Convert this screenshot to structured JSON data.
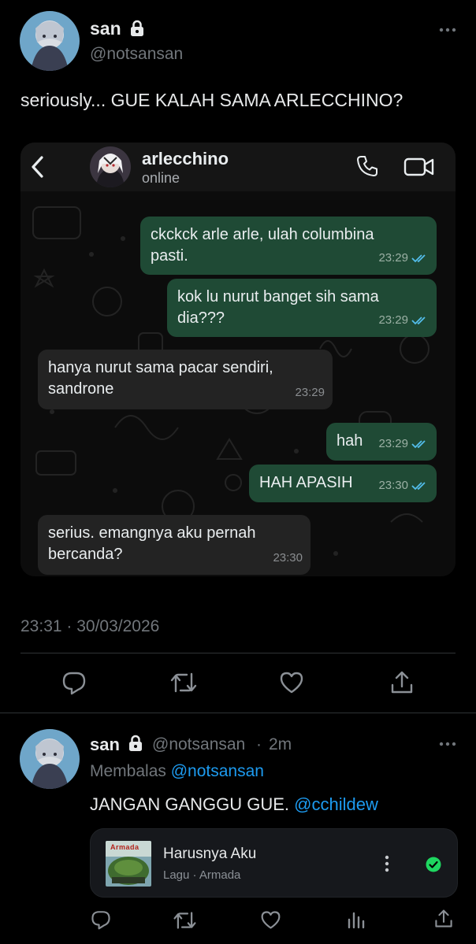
{
  "tweet": {
    "display_name": "san",
    "handle": "@notsansan",
    "text": "seriously... GUE KALAH SAMA ARLECCHINO?",
    "timestamp": "23:31 · 30/03/2026"
  },
  "chat": {
    "contact_name": "arlecchino",
    "status": "online",
    "messages": [
      {
        "text": "ckckck arle arle, ulah columbina\npasti.",
        "time": "23:29",
        "direction": "out"
      },
      {
        "text": "kok lu nurut banget sih sama\ndia???",
        "time": "23:29",
        "direction": "out"
      },
      {
        "text": "hanya nurut sama pacar sendiri,\nsandrone",
        "time": "23:29",
        "direction": "in"
      },
      {
        "text": "hah",
        "time": "23:29",
        "direction": "out"
      },
      {
        "text": "HAH APASIH",
        "time": "23:30",
        "direction": "out"
      },
      {
        "text": "serius. emangnya aku pernah\nbercanda?",
        "time": "23:30",
        "direction": "in"
      }
    ]
  },
  "reply": {
    "display_name": "san",
    "handle": "@notsansan",
    "time_ago": "2m",
    "replying_label": "Membalas",
    "replying_to": "@notsansan",
    "text": "JANGAN GANGGU GUE.",
    "mention": "@cchildew",
    "music": {
      "title": "Harusnya Aku",
      "subtitle": "Lagu · Armada",
      "album_text": "Armada"
    }
  },
  "colors": {
    "background": "#000000",
    "accent": "#1d9bf0",
    "outgoing_bubble": "#1f4a35",
    "incoming_bubble": "#232323",
    "spotify_green": "#1ed760"
  }
}
